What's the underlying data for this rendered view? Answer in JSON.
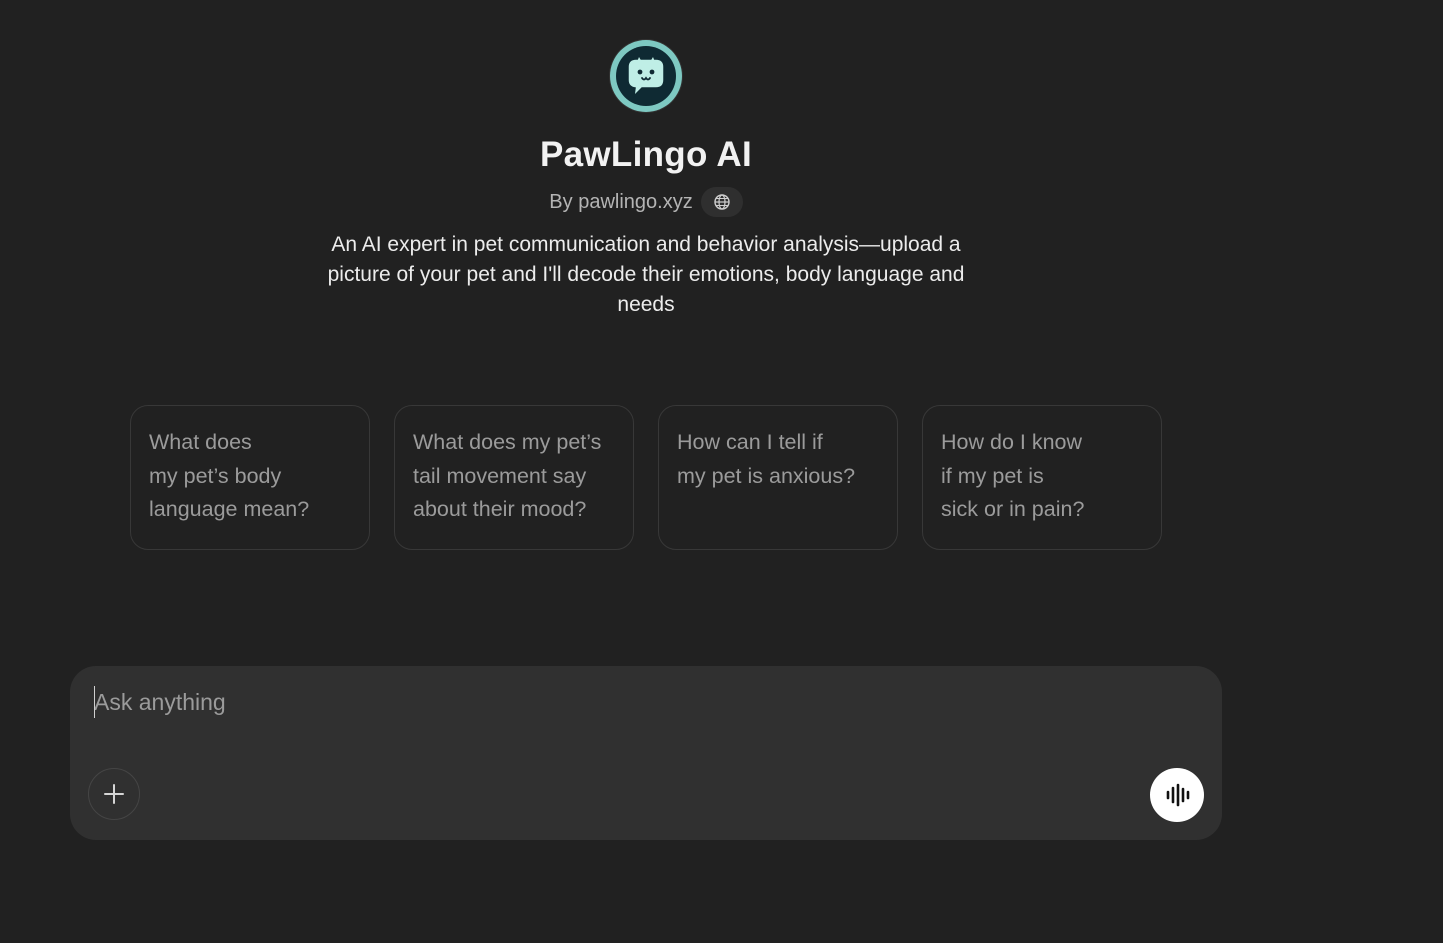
{
  "gpt": {
    "name": "PawLingo AI",
    "byline": "By pawlingo.xyz",
    "description": "An AI expert in pet communication and behavior analysis—upload a picture of your pet and I'll decode their emotions, body language and needs",
    "avatar_icon": "chat-bubble-cat-icon",
    "avatar_color": "#7ec9c2"
  },
  "starters": [
    {
      "label": "What does\nmy pet’s body\nlanguage mean?"
    },
    {
      "label": "What does my pet’s\ntail movement say\nabout their mood?"
    },
    {
      "label": "How can I tell if\nmy pet is anxious?"
    },
    {
      "label": "How do I know\nif my pet is\nsick or in pain?"
    }
  ],
  "composer": {
    "placeholder": "Ask anything",
    "value": "",
    "attach_icon": "plus-icon",
    "voice_icon": "voice-waveform-icon"
  },
  "colors": {
    "background": "#212121",
    "composer_bg": "#303030",
    "card_border": "#383838",
    "muted_text": "#9b9b9b"
  }
}
